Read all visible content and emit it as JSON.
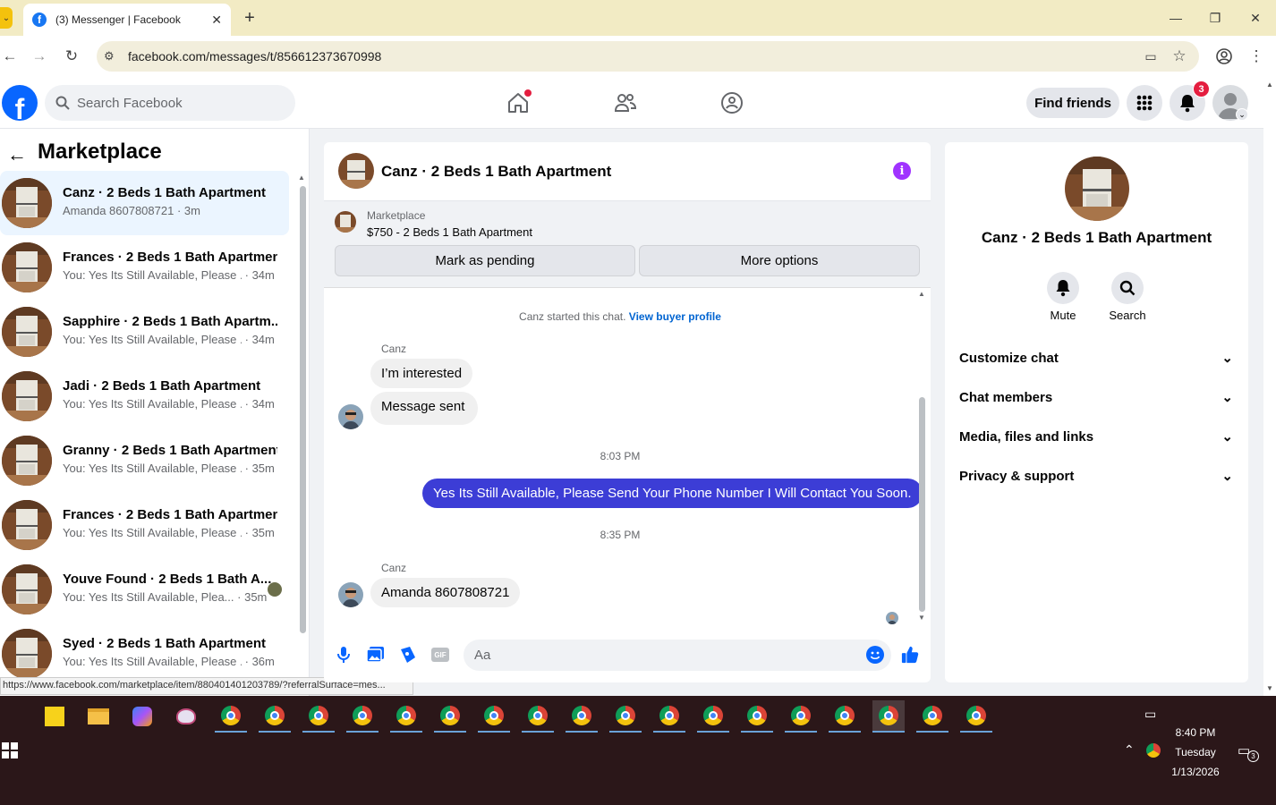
{
  "browser": {
    "tab_title": "(3) Messenger | Facebook",
    "url": "facebook.com/messages/t/856612373670998",
    "status_url": "https://www.facebook.com/marketplace/item/880401401203789/?referralSurface=mes..."
  },
  "fb_header": {
    "search_placeholder": "Search Facebook",
    "find_friends": "Find friends",
    "notification_count": "3"
  },
  "left_panel": {
    "title": "Marketplace",
    "conversations": [
      {
        "name": "Canz · 2 Beds 1 Bath Apartment",
        "preview": "Amanda 8607808721",
        "time": "3m",
        "active": true
      },
      {
        "name": "Frances · 2 Beds 1 Bath Apartment",
        "preview": "You: Yes Its Still Available, Please ...",
        "time": "34m"
      },
      {
        "name": "Sapphire · 2 Beds 1 Bath Apartm...",
        "preview": "You: Yes Its Still Available, Please ...",
        "time": "34m"
      },
      {
        "name": "Jadi · 2 Beds 1 Bath Apartment",
        "preview": "You: Yes Its Still Available, Please ...",
        "time": "34m"
      },
      {
        "name": "Granny · 2 Beds 1 Bath Apartment",
        "preview": "You: Yes Its Still Available, Please ...",
        "time": "35m"
      },
      {
        "name": "Frances · 2 Beds 1 Bath Apartment",
        "preview": "You: Yes Its Still Available, Please ...",
        "time": "35m"
      },
      {
        "name": "Youve Found · 2 Beds 1 Bath A...",
        "preview": "You: Yes Its Still Available, Plea...",
        "time": "35m"
      },
      {
        "name": "Syed · 2 Beds 1 Bath Apartment",
        "preview": "You: Yes Its Still Available, Please ...",
        "time": "36m"
      }
    ]
  },
  "chat": {
    "title": "Canz · 2 Beds 1 Bath Apartment",
    "marketplace_label": "Marketplace",
    "listing": "$750 - 2 Beds 1 Bath Apartment",
    "mark_pending": "Mark as pending",
    "more_options": "More options",
    "system_text": "Canz started this chat.",
    "view_buyer": "View buyer profile",
    "messages": {
      "sender1": "Canz",
      "msg1": "I’m interested",
      "msg2": "Message sent",
      "time1": "8:03 PM",
      "out1": "Yes Its Still Available, Please Send Your Phone Number I Will Contact You Soon.",
      "time2": "8:35 PM",
      "sender2": "Canz",
      "msg3": "Amanda 8607808721"
    },
    "input_placeholder": "Aa"
  },
  "right_panel": {
    "title": "Canz · 2 Beds 1 Bath Apartment",
    "mute": "Mute",
    "search": "Search",
    "rows": [
      "Customize chat",
      "Chat members",
      "Media, files and links",
      "Privacy & support"
    ]
  },
  "taskbar": {
    "time": "8:40 PM",
    "day": "Tuesday",
    "date": "1/13/2026",
    "notif_count": "3"
  },
  "colors": {
    "brand": "#0866ff",
    "outgoing_bubble": "#3c3dd6",
    "info_icon": "#a033ff",
    "badge": "#e41e3f"
  }
}
